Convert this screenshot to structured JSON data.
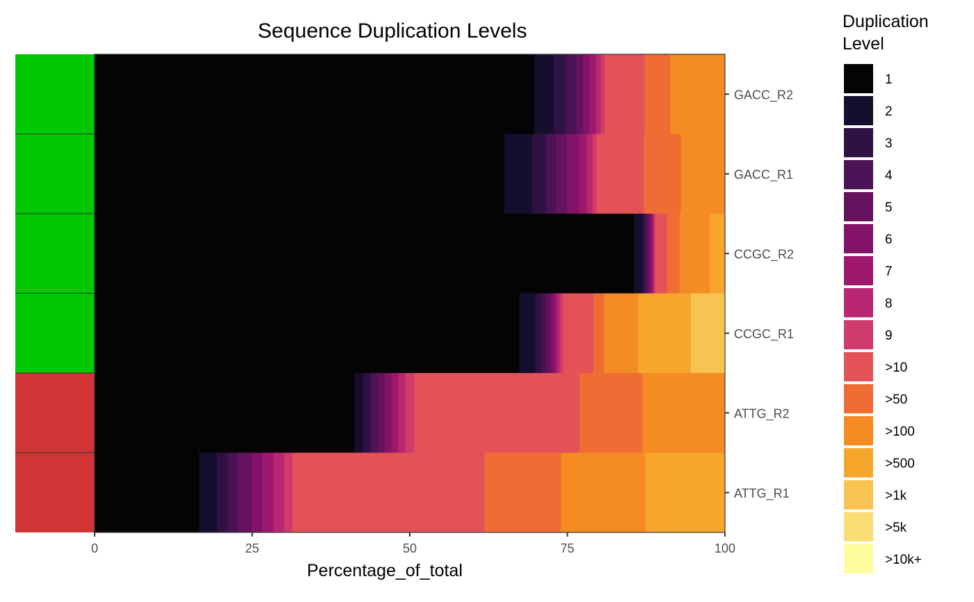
{
  "chart_data": {
    "type": "bar",
    "orientation": "horizontal",
    "stacked": true,
    "title": "Sequence Duplication Levels",
    "xlabel": "Percentage_of_total",
    "ylabel": "",
    "xlim": [
      0,
      100
    ],
    "xticks": [
      0,
      25,
      50,
      75,
      100
    ],
    "xtick_labels": [
      "0",
      "25",
      "50",
      "75",
      "100"
    ],
    "grid": false,
    "legend_position": "right",
    "legend_title": "Duplication Level",
    "legend_title_lines": [
      "Duplication",
      "Level"
    ],
    "categories": [
      "GACC_R2",
      "GACC_R1",
      "CCGC_R2",
      "CCGC_R1",
      "ATTG_R2",
      "ATTG_R1"
    ],
    "levels": [
      "1",
      "2",
      "3",
      "4",
      "5",
      "6",
      "7",
      "8",
      "9",
      ">10",
      ">50",
      ">100",
      ">500",
      ">1k",
      ">5k",
      ">10k+"
    ],
    "level_colors": [
      "#040404",
      "#160e2e",
      "#2f1244",
      "#4b1255",
      "#66125f",
      "#831269",
      "#9e186e",
      "#b82770",
      "#cf3c6b",
      "#e35257",
      "#f06c35",
      "#f48b23",
      "#f6a62c",
      "#f8c350",
      "#f9dd74",
      "#fdfd9e"
    ],
    "series_by_sample": {
      "GACC_R2": [
        69.8,
        3.0,
        2.0,
        1.6,
        1.1,
        1.0,
        1.0,
        0.8,
        0.6,
        6.4,
        4.0,
        8.7,
        0,
        0,
        0,
        0
      ],
      "GACC_R1": [
        65.0,
        4.4,
        2.2,
        1.6,
        1.7,
        1.9,
        1.3,
        0.9,
        0.6,
        7.5,
        5.9,
        7.0,
        0,
        0,
        0,
        0
      ],
      "CCGC_R2": [
        85.6,
        1.3,
        0.4,
        0.4,
        0.4,
        0.3,
        0.2,
        0.2,
        0.1,
        1.9,
        2.0,
        4.8,
        2.4,
        0,
        0,
        0
      ],
      "CCGC_R1": [
        67.4,
        2.5,
        1.0,
        0.8,
        0.7,
        0.6,
        0.4,
        0.4,
        0.5,
        4.8,
        1.7,
        5.4,
        8.4,
        5.4,
        0,
        0
      ],
      "ATTG_R2": [
        41.2,
        1.4,
        1.2,
        1.0,
        1.2,
        1.1,
        1.1,
        1.1,
        1.4,
        26.2,
        10.0,
        13.1,
        0,
        0,
        0,
        0
      ],
      "ATTG_R1": [
        16.6,
        2.8,
        1.7,
        1.7,
        2.1,
        1.7,
        1.7,
        1.8,
        1.3,
        30.5,
        12.1,
        13.4,
        12.6,
        0,
        0,
        0
      ]
    },
    "status_strip": {
      "GACC_R2": "pass",
      "GACC_R1": "pass",
      "CCGC_R2": "pass",
      "CCGC_R1": "pass",
      "ATTG_R2": "fail",
      "ATTG_R1": "fail"
    },
    "status_colors": {
      "pass": "#00c800",
      "fail": "#d03434"
    }
  }
}
